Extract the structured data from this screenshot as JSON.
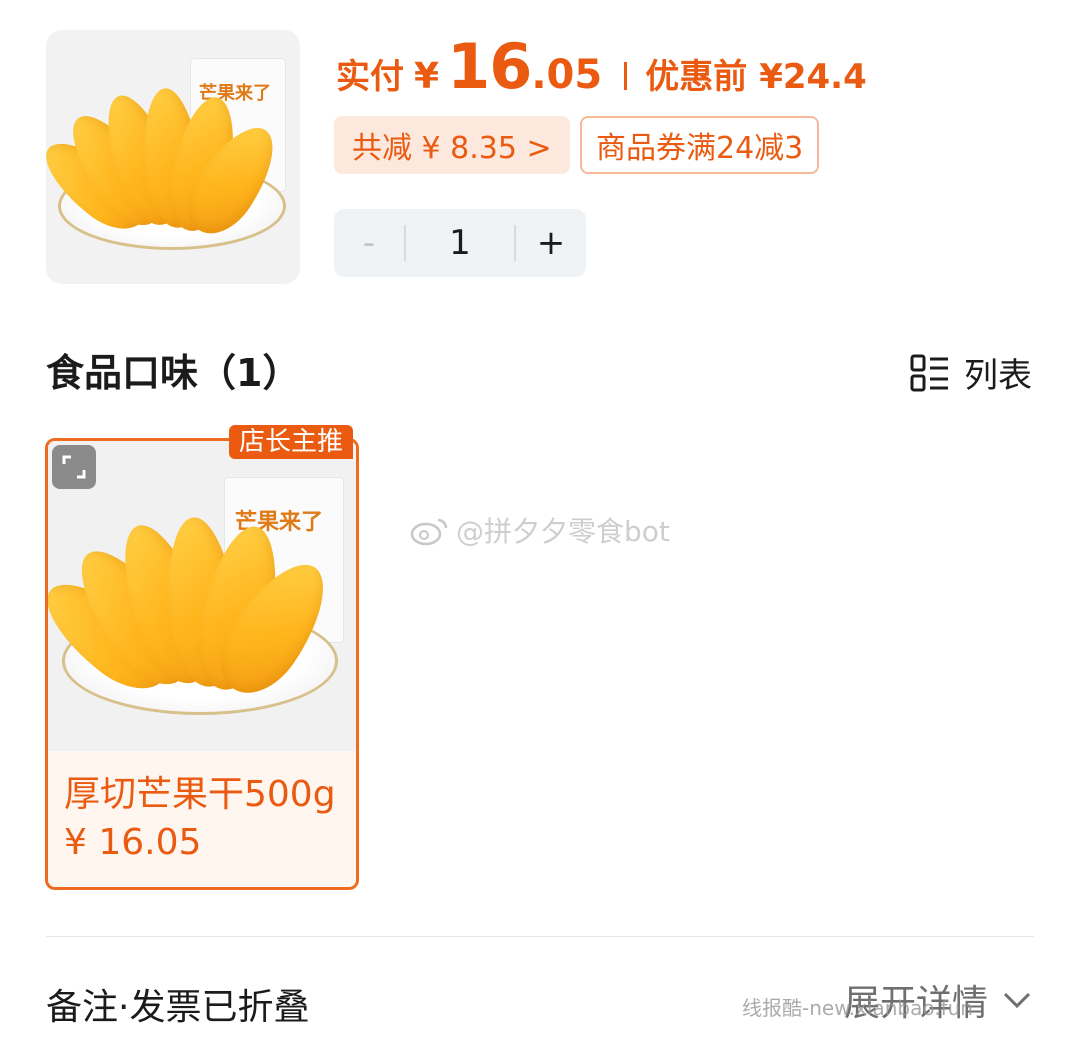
{
  "product": {
    "image_icon": "mango-product-photo",
    "brand_text": "芒果来了"
  },
  "price": {
    "paid_label": "实付",
    "currency": "¥",
    "paid_int": "16",
    "paid_dec": ".05",
    "orig_label": "优惠前",
    "orig_price": "¥24.4"
  },
  "discount": {
    "total_save": "共减 ¥ 8.35 >",
    "coupon": "商品券满24减3"
  },
  "stepper": {
    "minus": "-",
    "quantity": "1",
    "plus": "+"
  },
  "section": {
    "title": "食品口味（1）",
    "view_toggle": "列表",
    "view_icon": "list-icon"
  },
  "sku": {
    "badge": "店长主推",
    "name": "厚切芒果干500g ¥ 16.05",
    "expand_icon": "expand-icon"
  },
  "watermark": "@拼夕夕零食bot",
  "footer": {
    "remark": "备注·发票已折叠",
    "expand_detail": "展开详情",
    "source_mark": "线报酷-new.xianbao.fun"
  },
  "colors": {
    "accent": "#ea5a10",
    "save_bg": "#fde8de",
    "card_bg": "#fff6f0",
    "stepper_bg": "#f0f3f6"
  }
}
